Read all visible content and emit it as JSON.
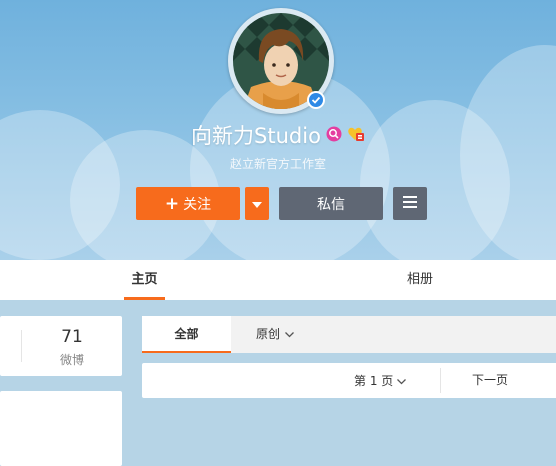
{
  "profile": {
    "name": "向新力Studio",
    "description": "赵立新官方工作室",
    "verified_color": "#2e8ae6"
  },
  "actions": {
    "follow_label": "关注",
    "follow_plus": "+",
    "message_label": "私信"
  },
  "tabs": [
    {
      "label": "主页",
      "active": true
    },
    {
      "label": "相册",
      "active": false
    }
  ],
  "stats": {
    "weibo_count": "71",
    "weibo_label": "微博"
  },
  "feed_filter": {
    "all_label": "全部",
    "original_label": "原创"
  },
  "pagination": {
    "page_label": "第 1 页",
    "next_label": "下一页"
  },
  "colors": {
    "accent": "#f76b1c",
    "button_dark": "#5f6774"
  },
  "icons": [
    "verified-badge-icon",
    "vip-icon",
    "heart-badge-icon",
    "chevron-down-icon",
    "menu-icon"
  ]
}
